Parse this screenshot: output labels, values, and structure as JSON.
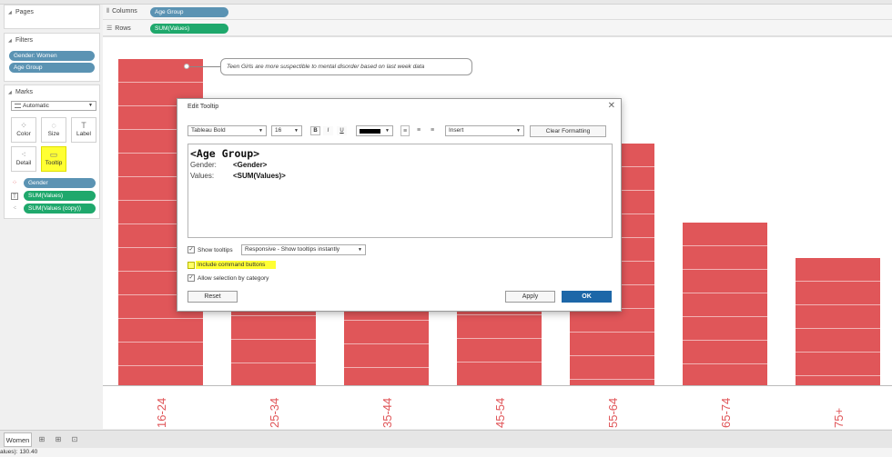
{
  "left_pane": {
    "pages_title": "Pages",
    "filters_title": "Filters",
    "filters": [
      "Gender: Women",
      "Age Group"
    ],
    "marks_title": "Marks",
    "mark_type": "Automatic",
    "mark_buttons": {
      "color": "Color",
      "size": "Size",
      "label": "Label",
      "detail": "Detail",
      "tooltip": "Tooltip"
    },
    "mark_fields": [
      "Gender",
      "SUM(Values)",
      "SUM(Values (copy))"
    ]
  },
  "shelves": {
    "columns_label": "Columns",
    "columns_pill": "Age Group",
    "rows_label": "Rows",
    "rows_pill": "SUM(Values)"
  },
  "annotation": "Teen Girls are more suspectible to mental disorder  based on last week data",
  "chart_data": {
    "type": "bar",
    "categories": [
      "16-24",
      "25-34",
      "35-44",
      "45-54",
      "55-64",
      "65-74",
      "75+"
    ],
    "values": [
      100,
      43,
      56,
      65,
      74,
      50,
      39
    ],
    "bar_color": "#e05659",
    "xlabel": "",
    "ylabel": ""
  },
  "dialog": {
    "title": "Edit Tooltip",
    "close_glyph": "✕",
    "font": "Tableau Bold",
    "size": "16",
    "bold": "B",
    "italic": "I",
    "underline": "U",
    "insert": "Insert",
    "clear_formatting": "Clear Formatting",
    "editor": {
      "heading": "<Age Group>",
      "rows": [
        {
          "label": "Gender:",
          "field": "<Gender>"
        },
        {
          "label": "Values:",
          "field": "<SUM(Values)>"
        }
      ]
    },
    "show_tooltips": "Show tooltips",
    "tooltip_mode": "Responsive - Show tooltips instantly",
    "include_command_buttons": "Include command buttons",
    "allow_selection": "Allow selection by category",
    "reset": "Reset",
    "apply": "Apply",
    "ok": "OK"
  },
  "bottom": {
    "sheet_tab": "Women",
    "status_text": "alues): 130.40"
  },
  "colors": {
    "pill_blue": "#5b93b3",
    "pill_green": "#1fa86c",
    "highlight": "#ffff33",
    "ok_button": "#1d67a8"
  }
}
